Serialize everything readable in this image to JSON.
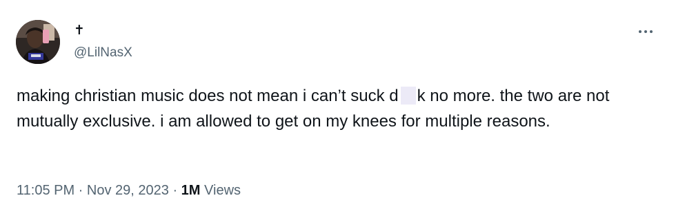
{
  "author": {
    "display_name": "✝",
    "handle": "@LilNasX",
    "avatar_icon": "profile-photo"
  },
  "more_icon": "ellipsis-icon",
  "tweet": {
    "text_part1": "making christian music does not mean i can’t suck d",
    "text_part2": "k no more. the two are not mutually exclusive. i am allowed to get on my knees for multiple reasons."
  },
  "meta": {
    "time": "11:05 PM",
    "sep1": " · ",
    "date": "Nov 29, 2023",
    "sep2": " · ",
    "views_count": "1M",
    "views_label": " Views"
  },
  "colors": {
    "text": "#0f1419",
    "secondary": "#536471",
    "censor": "#eceaf7"
  }
}
